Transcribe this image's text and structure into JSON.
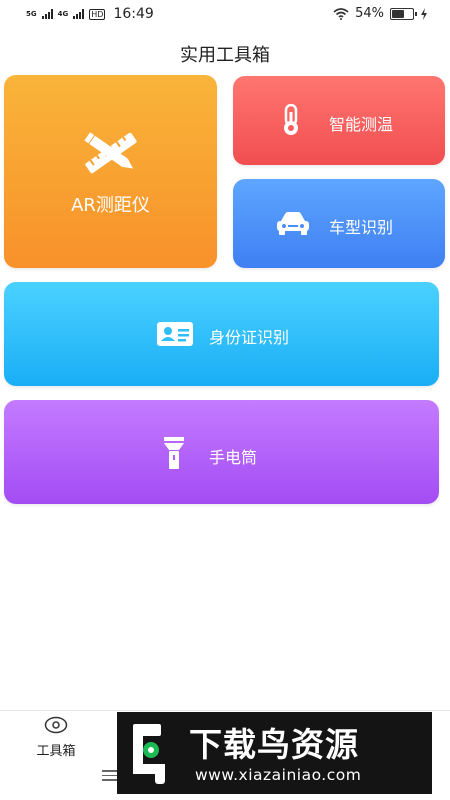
{
  "status_bar": {
    "signal_1": "5G",
    "signal_2": "4G",
    "hd": "HD",
    "time": "16:49",
    "battery_percent": "54%",
    "battery_level": 0.54
  },
  "header": {
    "title": "实用工具箱"
  },
  "tools": {
    "ar": {
      "label": "AR测距仪",
      "icon": "pencil-ruler-icon"
    },
    "temp": {
      "label": "智能测温",
      "icon": "thermometer-icon"
    },
    "car": {
      "label": "车型识别",
      "icon": "car-icon"
    },
    "id": {
      "label": "身份证识别",
      "icon": "id-card-icon"
    },
    "torch": {
      "label": "手电筒",
      "icon": "flashlight-icon"
    }
  },
  "bottom_nav": {
    "toolbox": {
      "label": "工具箱",
      "icon": "eye-icon"
    },
    "menu_icon": "menu-icon"
  },
  "watermark": {
    "title": "下载鸟资源",
    "url": "www.xiazainiao.com"
  },
  "colors": {
    "ar": "#f8a030",
    "temp": "#f75e5c",
    "car": "#4a8ff8",
    "id": "#2ebff9",
    "torch": "#b462f8"
  }
}
